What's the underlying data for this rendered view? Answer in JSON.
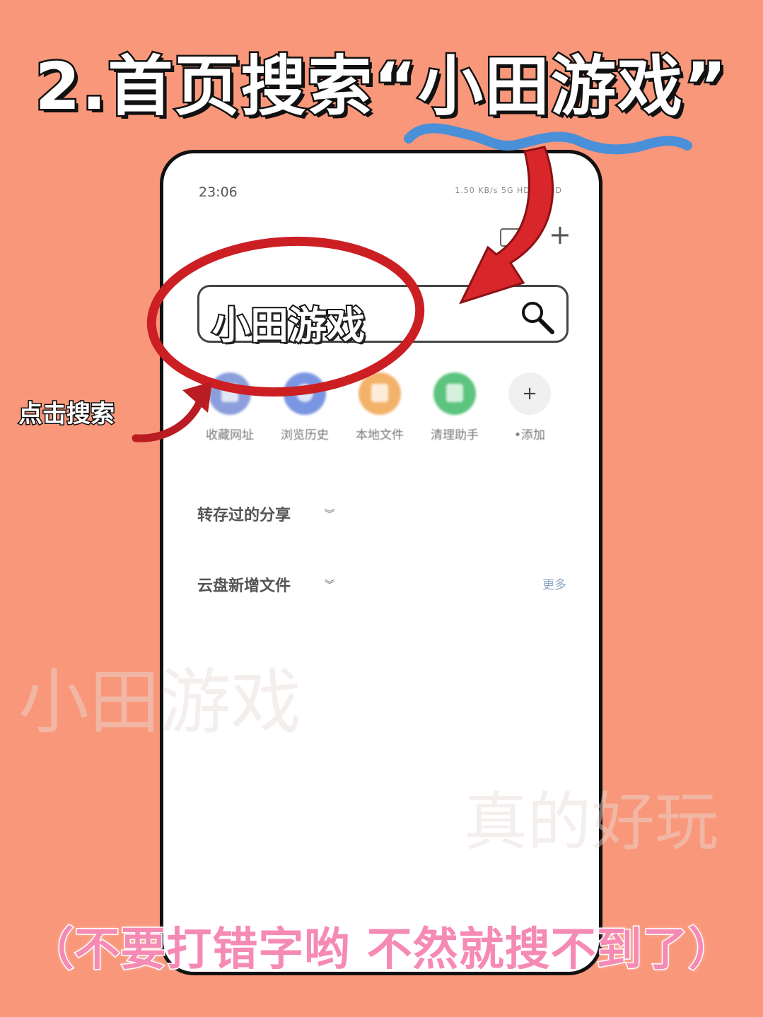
{
  "title": "2.首页搜索“小田游戏”",
  "status": {
    "time": "23:06",
    "right": "1.50 KB/s 5G HD 5G HD"
  },
  "search": {
    "value": "小田游戏"
  },
  "shortcuts": [
    {
      "label": "收藏网址",
      "color": "#8c9fdc"
    },
    {
      "label": "浏览历史",
      "color": "#7a96e2"
    },
    {
      "label": "本地文件",
      "color": "#f3b26a"
    },
    {
      "label": "清理助手",
      "color": "#5cc47e"
    },
    {
      "label": "•添加",
      "color": "#f0f0f0"
    }
  ],
  "sections": {
    "shared": "转存过的分享",
    "new_files": "云盘新增文件",
    "more": "更多"
  },
  "annotations": {
    "tap_note": "点击搜索",
    "watermark1": "小田游戏",
    "watermark2": "真的好玩"
  },
  "bottom_note": "（不要打错字哟 不然就搜不到了）",
  "colors": {
    "background": "#f9977a",
    "accent_red": "#cc1f24",
    "squiggle_blue": "#4a90d9",
    "note_pink": "#f58ab4"
  }
}
